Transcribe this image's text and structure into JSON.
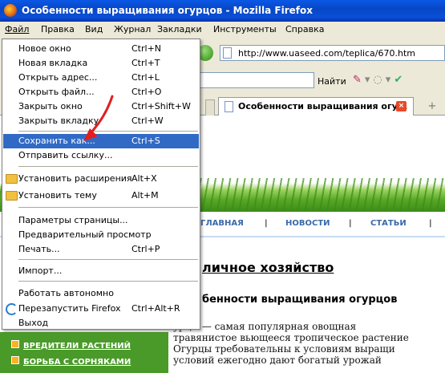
{
  "window": {
    "title": "Особенности выращивания огурцов - Mozilla Firefox"
  },
  "menubar": [
    "Файл",
    "Правка",
    "Вид",
    "Журнал",
    "Закладки",
    "Инструменты",
    "Справка"
  ],
  "address": {
    "url": "http://www.uaseed.com/teplica/670.htm"
  },
  "search": {
    "find_label": "Найти"
  },
  "tab": {
    "label": "Особенности выращивания огу...",
    "close_symbol": "×",
    "new_symbol": "+"
  },
  "file_menu": {
    "items": [
      {
        "label": "Новое окно",
        "shortcut": "Ctrl+N"
      },
      {
        "label": "Новая вкладка",
        "shortcut": "Ctrl+T"
      },
      {
        "label": "Открыть адрес...",
        "shortcut": "Ctrl+L"
      },
      {
        "label": "Открыть файл...",
        "shortcut": "Ctrl+O"
      },
      {
        "label": "Закрыть окно",
        "shortcut": "Ctrl+Shift+W"
      },
      {
        "label": "Закрыть вкладку",
        "shortcut": "Ctrl+W"
      },
      {
        "label": "Сохранить как...",
        "shortcut": "Ctrl+S"
      },
      {
        "label": "Отправить ссылку...",
        "shortcut": ""
      },
      {
        "label": "Установить расширения",
        "shortcut": "Alt+X"
      },
      {
        "label": "Установить тему",
        "shortcut": "Alt+M"
      },
      {
        "label": "Параметры страницы...",
        "shortcut": ""
      },
      {
        "label": "Предварительный просмотр",
        "shortcut": ""
      },
      {
        "label": "Печать...",
        "shortcut": "Ctrl+P"
      },
      {
        "label": "Импорт...",
        "shortcut": ""
      },
      {
        "label": "Работать автономно",
        "shortcut": ""
      },
      {
        "label": "Перезапустить Firefox",
        "shortcut": "Ctrl+Alt+R"
      },
      {
        "label": "Выход",
        "shortcut": ""
      }
    ],
    "selected_index": 6
  },
  "site": {
    "nav": [
      "ГЛАВНАЯ",
      "|",
      "НОВОСТИ",
      "|",
      "СТАТЬИ",
      "|"
    ],
    "heading": "личное хозяйство",
    "subheading": "бенности выращивания огурцов",
    "paragraph": [
      "урцы — самая популярная овощная",
      "травянистое вьющееся тропическое растение",
      "Огурцы требовательны к условиям выращи",
      "условий ежегодно дают богатый урожай"
    ],
    "side_links": [
      "ВРЕДИТЕЛИ РАСТЕНИЙ",
      "БОРЬБА С СОРНЯКАМИ"
    ]
  },
  "colors": {
    "titlebar": "#0a58e6",
    "menu_selected": "#316ac5",
    "arrow": "#e02020",
    "sidebar": "#4a9a2a"
  }
}
